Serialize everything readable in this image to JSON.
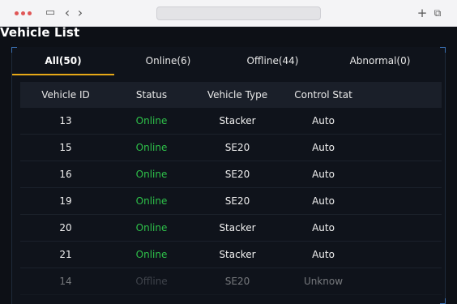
{
  "browser": {
    "window_dot_color": "#e05656",
    "new_tab_glyph": "+",
    "tabs_glyph": "⧉",
    "back_glyph": "‹",
    "forward_glyph": "›",
    "sidebar_glyph": "▭"
  },
  "page": {
    "title": "Vehicle List"
  },
  "tabs": [
    {
      "label": "All(50)",
      "active": true
    },
    {
      "label": "Online(6)",
      "active": false
    },
    {
      "label": "Offline(44)",
      "active": false
    },
    {
      "label": "Abnormal(0)",
      "active": false
    }
  ],
  "table": {
    "headers": [
      "Vehicle ID",
      "Status",
      "Vehicle Type",
      "Control Stat"
    ],
    "rows": [
      {
        "id": "13",
        "status": "Online",
        "type": "Stacker",
        "control": "Auto"
      },
      {
        "id": "15",
        "status": "Online",
        "type": "SE20",
        "control": "Auto"
      },
      {
        "id": "16",
        "status": "Online",
        "type": "SE20",
        "control": "Auto"
      },
      {
        "id": "19",
        "status": "Online",
        "type": "SE20",
        "control": "Auto"
      },
      {
        "id": "20",
        "status": "Online",
        "type": "Stacker",
        "control": "Auto"
      },
      {
        "id": "21",
        "status": "Online",
        "type": "Stacker",
        "control": "Auto"
      },
      {
        "id": "14",
        "status": "Offline",
        "type": "SE20",
        "control": "Unknow"
      }
    ]
  },
  "colors": {
    "accent_tab_underline": "#e6a817",
    "status_online": "#2ec24a",
    "status_offline": "#7a7f86",
    "background": "#0d1016"
  }
}
